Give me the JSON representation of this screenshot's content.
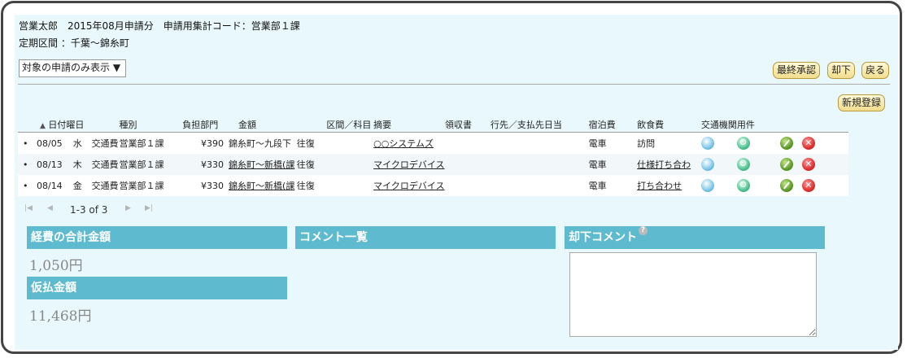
{
  "header": {
    "line1": "営業太郎　2015年08月申請分　申請用集計コード：営業部１課",
    "line2": "定期区間 ：千葉～錦糸町"
  },
  "filter": {
    "selected": "対象の申請のみ表示 ▼"
  },
  "buttons": {
    "final_approve": "最終承認",
    "reject": "却下",
    "back": "戻る",
    "new_entry": "新規登録"
  },
  "table": {
    "sort_indicator": "▲",
    "columns": [
      "日付曜日",
      "種別",
      "負担部門",
      "金額",
      "区間／科目",
      "摘要",
      "領収書",
      "行先／支払先",
      "日当",
      "宿泊費",
      "飲食費",
      "交通機関",
      "用件"
    ],
    "rows": [
      {
        "bullet": "•",
        "date": "08/05",
        "dow": "水",
        "type": "交通費",
        "dept": "営業部１課",
        "amount": "¥390",
        "route": "錦糸町～九段下",
        "note": "往復",
        "dest": "○○システムズ",
        "transport": "電車",
        "purpose": "訪問"
      },
      {
        "bullet": "•",
        "date": "08/13",
        "dow": "木",
        "type": "交通費",
        "dept": "営業部１課",
        "amount": "¥330",
        "route": "錦糸町～新橋(課",
        "note": "往復",
        "dest": "マイクロデバイス",
        "transport": "電車",
        "purpose": "仕様打ち合わ"
      },
      {
        "bullet": "•",
        "date": "08/14",
        "dow": "金",
        "type": "交通費",
        "dept": "営業部１課",
        "amount": "¥330",
        "route": "錦糸町～新橋(課",
        "note": "往復",
        "dest": "マイクロデバイス",
        "transport": "電車",
        "purpose": "打ち合わせ"
      }
    ]
  },
  "pager": {
    "text": "1-3 of 3"
  },
  "summary": {
    "total_label": "経費の合計金額",
    "total_value": "1,050円",
    "advance_label": "仮払金額",
    "advance_value": "11,468円",
    "comments_label": "コメント一覧",
    "reject_comment_label": "却下コメント"
  },
  "icons": {
    "first": "first-page-icon",
    "prev": "prev-page-icon",
    "next": "next-page-icon",
    "last": "last-page-icon",
    "view": "view-icon",
    "search": "search-icon",
    "edit": "edit-icon",
    "delete": "delete-icon",
    "help": "help-icon"
  },
  "colors": {
    "panel_bg": "#e9f8fc",
    "section_header": "#5ebbcf",
    "button_bg": "#f2dd8c"
  }
}
